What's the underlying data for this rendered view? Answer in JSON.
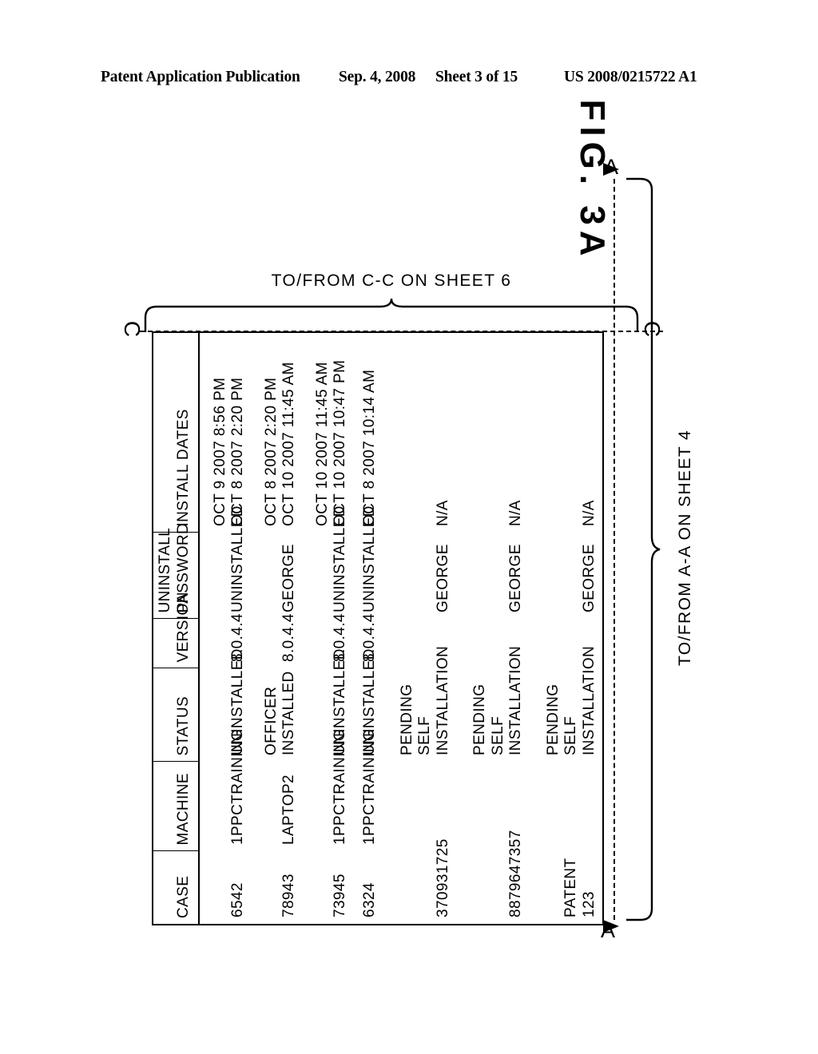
{
  "header": {
    "publication": "Patent Application Publication",
    "date": "Sep. 4, 2008",
    "sheet": "Sheet 3 of 15",
    "document_number": "US 2008/0215722 A1"
  },
  "figure": {
    "label": "FIG. 3A",
    "section_markers": {
      "cc_left": "C",
      "cc_right": "C",
      "aa_top": "A",
      "aa_bottom": "A"
    },
    "annotations": {
      "top_brace": "TO/FROM C-C ON SHEET 6",
      "right_brace": "TO/FROM A-A ON SHEET 4"
    }
  },
  "table": {
    "columns": [
      "CASE",
      "MACHINE",
      "STATUS",
      "VERSION",
      "UNINSTALL PASSWORD",
      "INSTALL DATES"
    ],
    "rows": [
      {
        "case": "6542",
        "machine": "1PPCTRAINING",
        "status": "UNINSTALLED",
        "version": "8.0.4.4",
        "uninstall_password": "UNINSTALLED",
        "install_dates": "OCT 9 2007 8:56 PM\nOCT 8 2007 2:20 PM"
      },
      {
        "case": "78943",
        "machine": "LAPTOP2",
        "status": "OFFICER INSTALLED",
        "version": "8.0.4.4",
        "uninstall_password": "GEORGE",
        "install_dates": "OCT 8 2007 2:20 PM\nOCT 10 2007 11:45 AM"
      },
      {
        "case": "73945",
        "machine": "1PPCTRAINING",
        "status": "UNINSTALLED",
        "version": "8.0.4.4",
        "uninstall_password": "UNINSTALLED",
        "install_dates": "OCT 10 2007 11:45 AM\nOCT 10 2007 10:47 PM"
      },
      {
        "case": "6324",
        "machine": "1PPCTRAINING",
        "status": "UNINSTALLED",
        "version": "8.0.4.4",
        "uninstall_password": "UNINSTALLED",
        "install_dates": "OCT 8 2007 10:14 AM"
      },
      {
        "case": "370931725",
        "machine": "",
        "status": "PENDING SELF INSTALLATION",
        "version": "",
        "uninstall_password": "GEORGE",
        "install_dates": "N/A"
      },
      {
        "case": "8879647357",
        "machine": "",
        "status": "PENDING SELF INSTALLATION",
        "version": "",
        "uninstall_password": "GEORGE",
        "install_dates": "N/A"
      },
      {
        "case": "PATENT 123",
        "machine": "",
        "status": "PENDING SELF INSTALLATION",
        "version": "",
        "uninstall_password": "GEORGE",
        "install_dates": "N/A"
      }
    ]
  }
}
